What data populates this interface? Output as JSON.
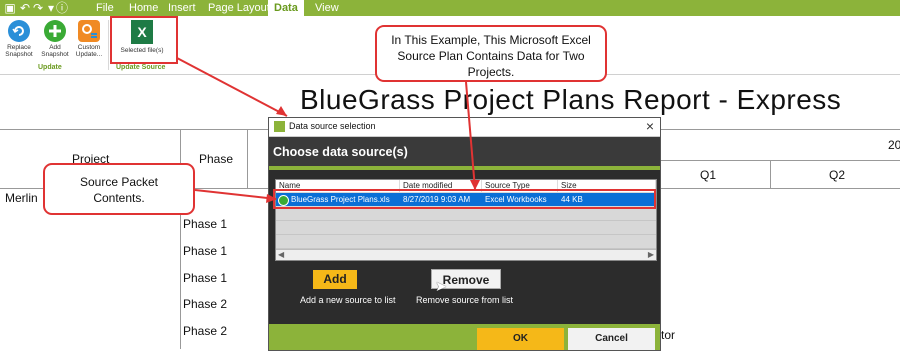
{
  "menubar": {
    "tabs": [
      "File",
      "Home",
      "Insert",
      "Page Layout",
      "Data",
      "View"
    ],
    "active_tab": "Data"
  },
  "ribbon": {
    "buttons": [
      {
        "label": "Replace Snapshot",
        "icon": "refresh-icon"
      },
      {
        "label": "Add Snapshot",
        "icon": "add-circle-icon"
      },
      {
        "label": "Custom Update...",
        "icon": "custom-update-icon"
      },
      {
        "label": "Selected file(s)",
        "icon": "excel-icon"
      }
    ],
    "groups": [
      "Update",
      "Update Source"
    ]
  },
  "report": {
    "title": "BlueGrass Project Plans Report - Express",
    "col_project": "Project",
    "col_phase": "Phase",
    "q1": "Q1",
    "q2": "Q2",
    "year_fragment": "20",
    "project_fragment": "Merlin",
    "phases": [
      "Phase 1",
      "Phase 1",
      "Phase 1",
      "Phase 2",
      "Phase 2"
    ],
    "tor_fragment": "tor"
  },
  "dialog": {
    "window_title": "Data source selection",
    "header": "Choose data source(s)",
    "columns": [
      "Name",
      "Date modified",
      "Source Type",
      "Size"
    ],
    "rows": [
      {
        "name": "BlueGrass Project Plans.xls",
        "date": "8/27/2019 9:03 AM",
        "type": "Excel Workbooks",
        "size": "44 KB"
      }
    ],
    "add_label": "Add",
    "add_caption": "Add a new source to list",
    "remove_label": "Remove",
    "remove_caption": "Remove source from list",
    "ok_label": "OK",
    "cancel_label": "Cancel",
    "close_glyph": "×"
  },
  "callouts": {
    "example": "In This Example, This Microsoft Excel Source Plan Contains Data for Two Projects.",
    "source_packet": "Source Packet Contents."
  },
  "colors": {
    "accent_green": "#8cb33a",
    "highlight_blue": "#0a6fd6",
    "button_yellow": "#f5b818",
    "callout_red": "#e03333"
  }
}
